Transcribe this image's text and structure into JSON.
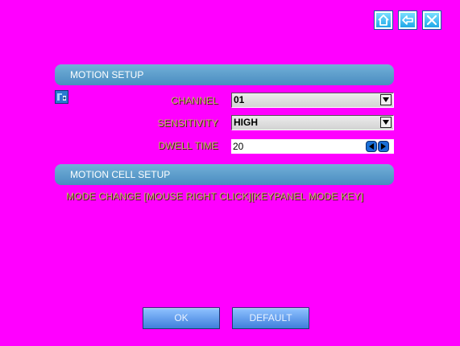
{
  "nav": {
    "home_icon": "home-icon",
    "back_icon": "back-arrow-icon",
    "close_icon": "close-icon"
  },
  "motion_setup": {
    "title": "MOTION SETUP",
    "channel": {
      "label": "CHANNEL",
      "value": "01"
    },
    "sensitivity": {
      "label": "SENSITIVITY",
      "value": "HIGH"
    },
    "dwell_time": {
      "label": "DWELL TIME",
      "value": "20"
    }
  },
  "motion_cell_setup": {
    "title": "MOTION CELL SETUP",
    "instruction": "MODE CHANGE [MOUSE RIGHT CLICK][KEYPANEL MODE KEY]"
  },
  "buttons": {
    "ok": "OK",
    "default": "DEFAULT"
  },
  "colors": {
    "background": "#ff00ff",
    "section_bar": "#5a9ccc",
    "button": "#5a9af0",
    "label_text": "#c8b070"
  }
}
